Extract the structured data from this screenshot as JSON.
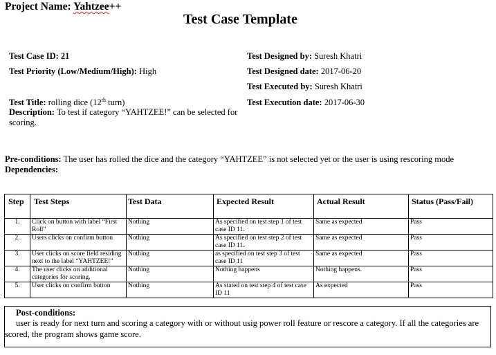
{
  "header": {
    "project_label": "Project Name:",
    "project_name": "Yahtzee",
    "project_suffix": "++",
    "title": "Test Case Template"
  },
  "fields": {
    "test_case_id_label": "Test Case ID:",
    "test_case_id": "21",
    "priority_label": "Test Priority (Low/Medium/High):",
    "priority": "High",
    "designed_by_label": "Test Designed by:",
    "designed_by": "Suresh Khatri",
    "designed_date_label": "Test Designed date:",
    "designed_date": "2017-06-20",
    "executed_by_label": "Test Executed by:",
    "executed_by": "Suresh Khatri",
    "execution_date_label": "Test Execution date:",
    "execution_date": "2017-06-30",
    "title_label": "Test Title:",
    "title_pre": "rolling dice (12",
    "title_sup": "th",
    "title_post": " turn)",
    "description_label": "Description:",
    "description": "To test if category “YAHTZEE!” can be selected for scoring."
  },
  "preconditions": {
    "label": "Pre-conditions:",
    "text": "The user has rolled the dice and the category “YAHTZEE” is not selected yet or the user is using rescoring mode"
  },
  "dependencies": {
    "label": "Dependencies:"
  },
  "table": {
    "headers": {
      "step": "Step",
      "test_steps": "Test Steps",
      "test_data": "Test Data",
      "expected": "Expected Result",
      "actual": "Actual Result",
      "status": "Status (Pass/Fail)"
    },
    "rows": [
      {
        "step": "1.",
        "action": "Click on button with label “First Roll”",
        "data": "Nothing",
        "expected": "As specified on test step 1 of test case ID 11.",
        "actual": "Same as expected",
        "status": "Pass"
      },
      {
        "step": "2.",
        "action": "Users clicks on confirm button",
        "data": "Nothing",
        "expected": "As specified on test step 2 of test case ID 11.",
        "actual": "Same as expected",
        "status": "Pass"
      },
      {
        "step": "3.",
        "action": "User clicks on score field residing next to the label “YAHTZEE!”",
        "data": "Nothing",
        "expected": "as specified on test step 3 of test case ID 11",
        "actual": "Same as expected",
        "status": "Pass"
      },
      {
        "step": "4.",
        "action": "The user clicks on additional categories for scoring.",
        "data": "Nothing",
        "expected": "Nothing happens",
        "actual": "Nothing happens.",
        "status": "Pass"
      },
      {
        "step": "5.",
        "action": "User clicks on confirm button",
        "data": "Nothing",
        "expected": "As stated on test step 4 of test case ID 11",
        "actual": "As expected",
        "status": "Pass"
      }
    ]
  },
  "postconditions": {
    "label": "Post-conditions:",
    "text": "user is ready for next turn and scoring a category with or without usig power roll  feature or rescore a category. If all the categories are scored, the program shows game score."
  }
}
